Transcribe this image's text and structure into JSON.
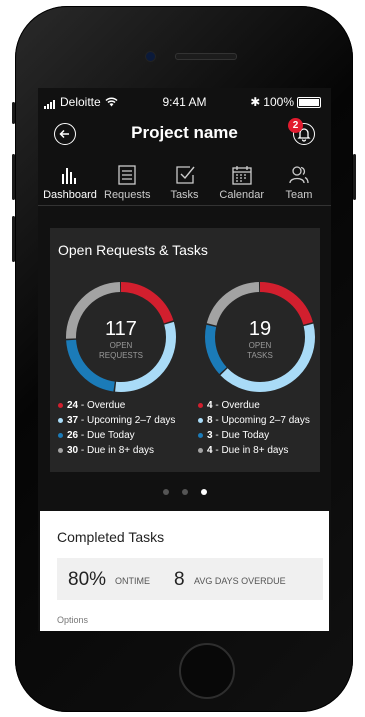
{
  "status_bar": {
    "carrier": "Deloitte",
    "time": "9:41 AM",
    "battery": "100%"
  },
  "header": {
    "title": "Project name",
    "notification_count": "2"
  },
  "tabs": [
    {
      "label": "Dashboard",
      "icon": "bar-chart-icon",
      "active": true
    },
    {
      "label": "Requests",
      "icon": "list-icon",
      "active": false
    },
    {
      "label": "Tasks",
      "icon": "checkbox-icon",
      "active": false
    },
    {
      "label": "Calendar",
      "icon": "calendar-icon",
      "active": false
    },
    {
      "label": "Team",
      "icon": "team-icon",
      "active": false
    }
  ],
  "open_card": {
    "title": "Open Requests & Tasks",
    "requests": {
      "count": "117",
      "label_line1": "OPEN",
      "label_line2": "REQUESTS",
      "breakdown": [
        {
          "value": "24",
          "label": " - Overdue",
          "color": "#d21f2e"
        },
        {
          "value": "37",
          "label": " - Upcoming 2–7 days",
          "color": "#a9dbf7"
        },
        {
          "value": "26",
          "label": " - Due Today",
          "color": "#1b7bb8"
        },
        {
          "value": "30",
          "label": " - Due in 8+ days",
          "color": "#a3a3a3"
        }
      ]
    },
    "tasks": {
      "count": "19",
      "label_line1": "OPEN",
      "label_line2": "TASKS",
      "breakdown": [
        {
          "value": "4",
          "label": " - Overdue",
          "color": "#d21f2e"
        },
        {
          "value": "8",
          "label": " - Upcoming 2–7 days",
          "color": "#a9dbf7"
        },
        {
          "value": "3",
          "label": " - Due Today",
          "color": "#1b7bb8"
        },
        {
          "value": "4",
          "label": " - Due in 8+ days",
          "color": "#a3a3a3"
        }
      ]
    }
  },
  "pager": {
    "count": 3,
    "active_index": 2
  },
  "completed": {
    "title": "Completed Tasks",
    "ontime_value": "80%",
    "ontime_label": "ONTIME",
    "overdue_value": "8",
    "overdue_label": "AVG DAYS OVERDUE",
    "next_label": "Options"
  },
  "colors": {
    "accent_red": "#e21b2e",
    "dark_bg": "#111111",
    "card_bg": "#262626"
  }
}
